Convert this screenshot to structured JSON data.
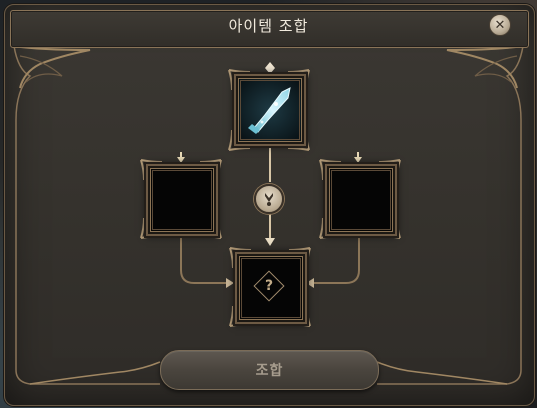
{
  "window": {
    "title": "아이템 조합",
    "close_icon": "close-icon"
  },
  "slots": {
    "top": {
      "filled": true,
      "item_icon": "crystal-dagger-icon"
    },
    "left": {
      "filled": false
    },
    "right": {
      "filled": false
    },
    "result": {
      "symbol": "?"
    }
  },
  "combine_button": {
    "label": "조합"
  },
  "colors": {
    "frame": "#8a7458",
    "arrow": "#d8c6a6",
    "item_glow": "#a8e8f2"
  }
}
